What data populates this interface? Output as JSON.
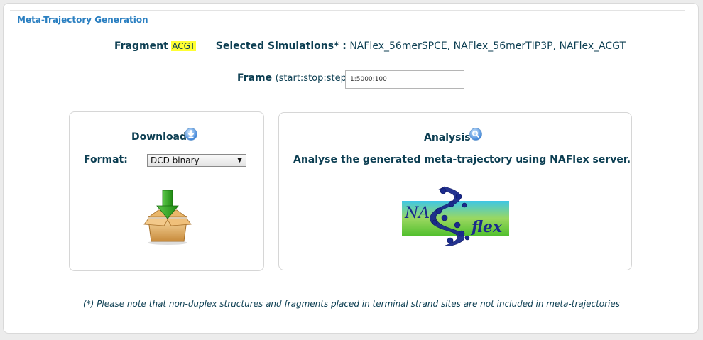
{
  "panel": {
    "title": "Meta-Trajectory Generation"
  },
  "fragment": {
    "label": "Fragment",
    "value": "ACGT",
    "highlight_color": "#ffff33"
  },
  "simulations": {
    "label": "Selected Simulations* :",
    "value": "NAFlex_56merSPCE, NAFlex_56merTIP3P, NAFlex_ACGT"
  },
  "frame": {
    "label": "Frame",
    "hint": "(start:stop:step)",
    "value": "1:5000:100"
  },
  "download": {
    "heading": "Download",
    "heading_icon": "download-arrow-icon",
    "format_label": "Format:",
    "format_selected": "DCD binary",
    "image_icon": "download-box-icon"
  },
  "analysis": {
    "heading": "Analysis",
    "heading_icon": "magnifier-icon",
    "text": "Analyse the generated meta-trajectory using NAFlex server.",
    "logo": {
      "left_text": "NA",
      "right_text": "flex"
    }
  },
  "note": "(*) Please note that non-duplex structures and fragments placed in terminal strand sites are not included in meta-trajectories",
  "colors": {
    "title_blue": "#2a7fc1",
    "text_dark": "#0c3e52",
    "icon_blue": "#3b82d8",
    "download_green": "#2fa21d"
  }
}
